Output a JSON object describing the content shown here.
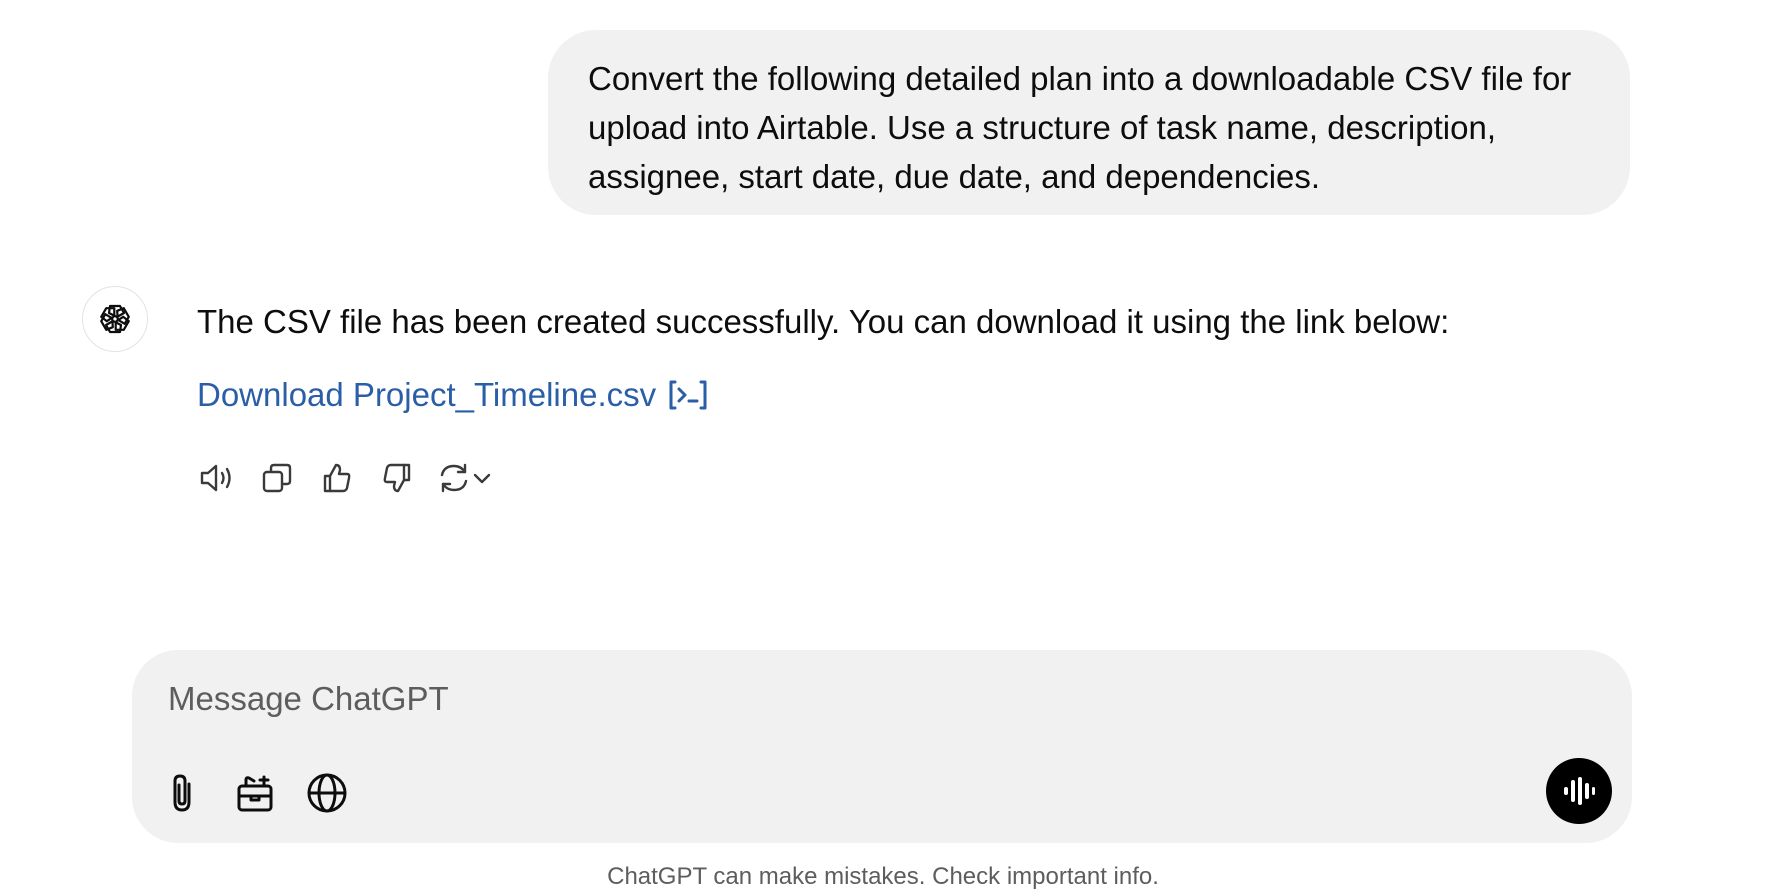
{
  "conversation": {
    "user_message": "Convert the following detailed plan into a downloadable CSV file for upload into Airtable. Use a structure of task name, description, assignee, start date, due date, and dependencies.",
    "assistant_message": "The CSV file has been created successfully. You can download it using the link below:",
    "download_link_label": "Download Project_Timeline.csv",
    "link_color": "#2a5ea6",
    "actions": [
      "speaker-icon",
      "copy-icon",
      "thumbs-up-icon",
      "thumbs-down-icon",
      "regenerate-icon",
      "chevron-down-icon"
    ]
  },
  "composer": {
    "placeholder": "Message ChatGPT",
    "tools": [
      "paperclip-icon",
      "toolbox-icon",
      "globe-icon"
    ],
    "voice_button": "voice-waveform-icon"
  },
  "footer": {
    "disclaimer": "ChatGPT can make mistakes. Check important info."
  }
}
